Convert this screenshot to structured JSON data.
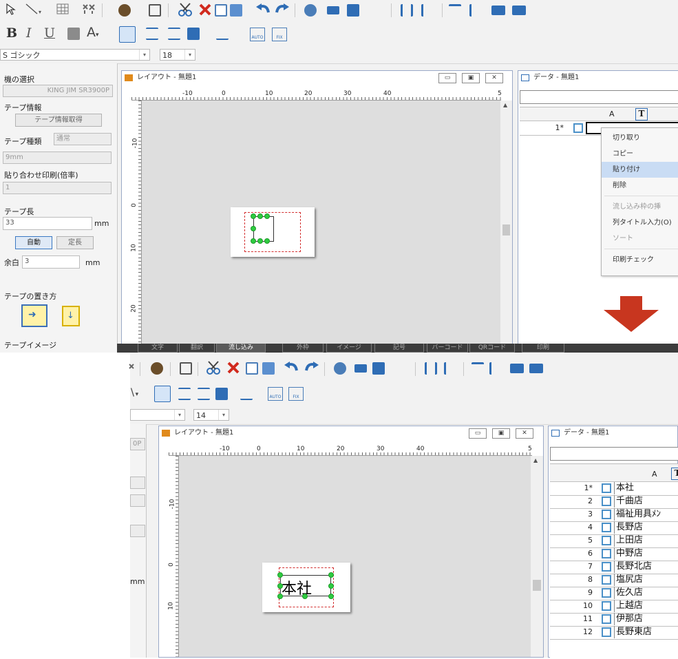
{
  "top": {
    "font_name": "S ゴシック",
    "font_size": "18",
    "panel": {
      "printer_label": "機の選択",
      "printer_value": "KING JIM SR3900P",
      "tape_info_label": "テープ情報",
      "tape_info_button": "テープ情報取得",
      "tape_type_label": "テープ種類",
      "tape_type_value": "通常",
      "tape_width_value": "9mm",
      "paste_print_label": "貼り合わせ印刷(倍率)",
      "paste_print_value": "1",
      "tape_length_label": "テープ長",
      "tape_length_value": "33",
      "tape_length_unit": "mm",
      "auto_button": "自動",
      "fixed_button": "定長",
      "margin_label": "余白",
      "margin_value": "3",
      "margin_unit": "mm",
      "tape_orientation_label": "テープの置き方",
      "tape_image_label": "テープイメージ"
    },
    "layout_title": "レイアウト - 無題1",
    "data_title": "データ - 無題1",
    "ruler_numbers": [
      "-10",
      "0",
      "10",
      "20",
      "30",
      "40",
      "5"
    ],
    "vruler_numbers": [
      "-10",
      "0",
      "10",
      "20"
    ],
    "grid_col_header": "A",
    "grid_row_1": "1*",
    "context_menu": [
      "切り取り",
      "コピー",
      "貼り付け",
      "削除",
      "流し込み枠の挿",
      "列タイトル入力(O)",
      "ソート",
      "印刷チェック"
    ],
    "context_menu_highlight": "貼り付け",
    "tabs": [
      "文字",
      "翻訳",
      "流し込み",
      "外枠",
      "イメージ",
      "記号",
      "バーコード",
      "QRコード",
      "印刷"
    ]
  },
  "bottom": {
    "font_size": "14",
    "panel_fragment": "0P",
    "panel_unit": "mm",
    "layout_title": "レイアウト - 無題1",
    "data_title": "データ - 無題1",
    "label_text": "本社",
    "grid_col_header": "A",
    "rows": [
      {
        "num": "1*",
        "value": "本社"
      },
      {
        "num": "2",
        "value": "千曲店"
      },
      {
        "num": "3",
        "value": "福祉用具ﾒﾝ"
      },
      {
        "num": "4",
        "value": "長野店"
      },
      {
        "num": "5",
        "value": "上田店"
      },
      {
        "num": "6",
        "value": "中野店"
      },
      {
        "num": "7",
        "value": "長野北店"
      },
      {
        "num": "8",
        "value": "塩尻店"
      },
      {
        "num": "9",
        "value": "佐久店"
      },
      {
        "num": "10",
        "value": "上越店"
      },
      {
        "num": "11",
        "value": "伊那店"
      },
      {
        "num": "12",
        "value": "長野東店"
      }
    ]
  },
  "colors": {
    "arrow": "#c8361f",
    "accent": "#2f6db5",
    "handle_green": "#2ecc40",
    "highlight": "#c9dcf4"
  },
  "icons": [
    "cursor-icon",
    "line-icon",
    "table-icon",
    "scissors-icon",
    "cut-icon",
    "delete-icon",
    "copy-icon",
    "paste-icon",
    "undo-icon",
    "redo-icon",
    "align-icon",
    "bold-icon",
    "italic-icon",
    "underline-icon"
  ]
}
